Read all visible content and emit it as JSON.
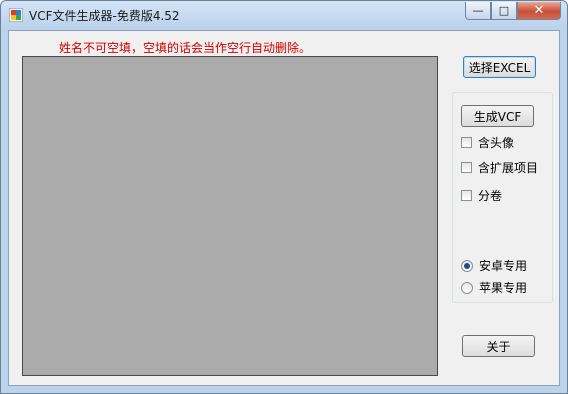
{
  "window": {
    "title": "VCF文件生成器-免费版4.52",
    "min_glyph": "—",
    "max_glyph": "□",
    "close_glyph": "✕"
  },
  "notice": "姓名不可空填，空填的话会当作空行自动删除。",
  "buttons": {
    "select_excel": "选择EXCEL",
    "generate_vcf": "生成VCF",
    "about": "关于"
  },
  "options": {
    "include_avatar": {
      "label": "含头像",
      "checked": false
    },
    "include_extended": {
      "label": "含扩展项目",
      "checked": false
    },
    "split_volumes": {
      "label": "分卷",
      "checked": false
    }
  },
  "platform": {
    "android": {
      "label": "安卓专用",
      "selected": true
    },
    "apple": {
      "label": "苹果专用",
      "selected": false
    }
  },
  "colors": {
    "notice": "#d00000",
    "preview_bg": "#ababab",
    "form_bg": "#f0f0f0"
  }
}
